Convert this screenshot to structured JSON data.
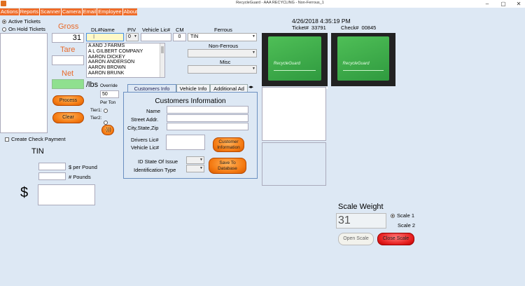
{
  "window": {
    "title": "RecycleGuard - AAA RECYCLING - Non-Ferrous_1",
    "minimize": "–",
    "maximize": "▢",
    "close": "✕"
  },
  "menu": [
    "Actions",
    "Reports",
    "Scanner",
    "Camera",
    "Email",
    "Employee",
    "About"
  ],
  "tickets": {
    "active_label": "Active Tickets",
    "on_hold_label": "On Hold Tickets",
    "selected": "active"
  },
  "weights": {
    "gross_label": "Gross",
    "gross_value": "31",
    "tare_label": "Tare",
    "tare_value": "",
    "net_label": "Net",
    "net_value": ""
  },
  "buttons": {
    "process": "Process",
    "clear": "Clear",
    "audio": "·)))",
    "customer_info": "Customer Information",
    "save_to_db": "Save To Database",
    "open_scale": "Open Scale",
    "close_scale": "Close Scale"
  },
  "header_fields": {
    "dl_label": "DL#Name",
    "dl_value": "",
    "piv_label": "PIV",
    "piv_value": "0",
    "vehicle_lic_label": "Vehicle Lic#",
    "vehicle_lic_value": "",
    "cm_label": "CM",
    "cm_value": "0"
  },
  "customers": [
    "A AND J FARMS",
    "A L GILBERT COMPANY",
    "AARON DICKEY",
    "AARON ANDERSON",
    "AARON BROWN",
    "AARON BRUNK"
  ],
  "pricing": {
    "per_lbs_label": "/lbs",
    "override_label": "Override",
    "override_value": "50",
    "per_ton_label": "Per Ton",
    "tier1_label": "Tier1:",
    "tier2_label": "Tier2:"
  },
  "materials": {
    "ferrous_label": "Ferrous",
    "ferrous_value": "TIN",
    "non_ferrous_label": "Non-Ferrous",
    "non_ferrous_value": "",
    "misc_label": "Misc",
    "misc_value": ""
  },
  "ticket_info": {
    "datetime": "4/26/2018 4:35:19 PM",
    "ticket_label": "Ticket#",
    "ticket_number": "33791",
    "check_label": "Check#",
    "check_number": "00845"
  },
  "camera": {
    "logo_text": "RecycleGuard"
  },
  "tabs": [
    {
      "label": "Customers Info",
      "active": true
    },
    {
      "label": "Vehicle Info",
      "active": false
    },
    {
      "label": "Additional Ad",
      "active": false
    }
  ],
  "tab_scroll": "◂▸",
  "customer_info": {
    "heading": "Customers Information",
    "name_label": "Name",
    "street_label": "Street Addr.",
    "city_label": "City,State,Zip",
    "drivers_lic_label": "Drivers Lic#",
    "vehicle_lic_label": "Vehicle Lic#",
    "id_state_label": "ID State Of Issue",
    "id_type_label": "Identification Type"
  },
  "payment": {
    "check_label": "Create Check Payment",
    "material_name": "TIN",
    "per_pound_label": "$ per Pound",
    "pounds_label": "# Pounds",
    "dollar_sign": "$"
  },
  "scale": {
    "title": "Scale Weight",
    "value": "31",
    "scale1_label": "Scale 1",
    "scale2_label": "Scale 2",
    "selected": "Scale 1"
  }
}
